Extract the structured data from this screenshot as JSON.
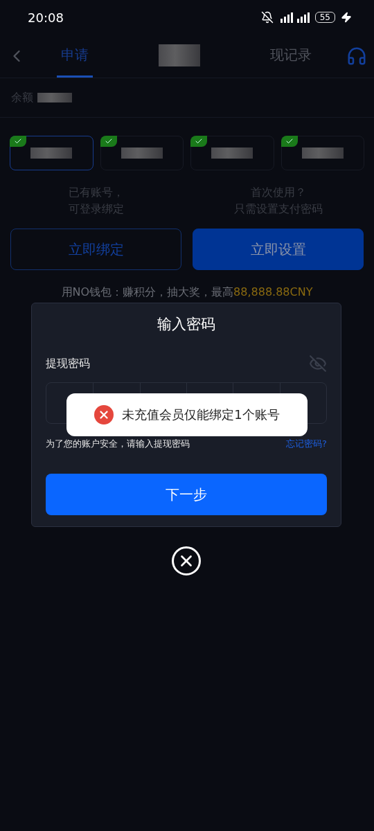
{
  "status_bar": {
    "time": "20:08",
    "battery": "55"
  },
  "header": {
    "tabs": [
      {
        "label": "申请",
        "selected": true
      },
      {
        "selected": false,
        "kind": "redacted"
      },
      {
        "label": "现记录",
        "selected": false
      }
    ]
  },
  "balance": {
    "label": "余额"
  },
  "wallets": [
    {
      "selected": true,
      "checked": true
    },
    {
      "selected": false,
      "checked": true
    },
    {
      "selected": false,
      "checked": true
    },
    {
      "selected": false,
      "checked": true
    }
  ],
  "options": [
    {
      "hint": [
        "已有账号，",
        "可登录绑定"
      ],
      "button": "立即绑定",
      "kind": "outline"
    },
    {
      "hint": [
        "首次使用？",
        "只需设置支付密码"
      ],
      "button": "立即设置",
      "kind": "filled"
    }
  ],
  "promo": {
    "text": "用NO钱包：赚积分，抽大奖，最高",
    "amount": "88,888.88CNY"
  },
  "dialog": {
    "title": "输入密码",
    "field_label": "提现密码",
    "password_visible": false,
    "hint": "为了您的账户安全，请输入提现密码",
    "forgot": "忘记密码?",
    "submit": "下一步"
  },
  "toast": {
    "message": "未充值会员仅能绑定1个账号"
  }
}
